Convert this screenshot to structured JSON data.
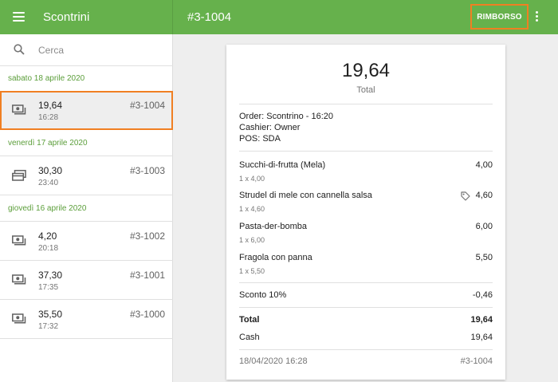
{
  "topbar": {
    "title": "Scontrini",
    "receipt_number": "#3-1004",
    "refund_label": "RIMBORSO"
  },
  "search": {
    "placeholder": "Cerca"
  },
  "groups": [
    {
      "date": "sabato 18 aprile 2020",
      "receipts": [
        {
          "amount": "19,64",
          "time": "16:28",
          "number": "#3-1004",
          "icon": "cash-icon",
          "selected": true
        }
      ]
    },
    {
      "date": "venerdì 17 aprile 2020",
      "receipts": [
        {
          "amount": "30,30",
          "time": "23:40",
          "number": "#3-1003",
          "icon": "card-icon"
        }
      ]
    },
    {
      "date": "giovedì 16 aprile 2020",
      "receipts": [
        {
          "amount": "4,20",
          "time": "20:18",
          "number": "#3-1002",
          "icon": "cash-icon"
        },
        {
          "amount": "37,30",
          "time": "17:35",
          "number": "#3-1001",
          "icon": "cash-icon"
        },
        {
          "amount": "35,50",
          "time": "17:32",
          "number": "#3-1000",
          "icon": "cash-icon"
        }
      ]
    }
  ],
  "receipt": {
    "total": "19,64",
    "total_label": "Total",
    "order": "Order: Scontrino - 16:20",
    "cashier": "Cashier: Owner",
    "pos": "POS: SDA",
    "items": [
      {
        "name": "Succhi-di-frutta (Mela)",
        "qty": "1 x 4,00",
        "price": "4,00"
      },
      {
        "name": "Strudel di mele con cannella salsa",
        "qty": "1 x 4,60",
        "price": "4,60",
        "tag_icon": "tag-icon"
      },
      {
        "name": "Pasta-der-bomba",
        "qty": "1 x 6,00",
        "price": "6,00"
      },
      {
        "name": "Fragola con panna",
        "qty": "1 x 5,50",
        "price": "5,50"
      }
    ],
    "discount_label": "Sconto 10%",
    "discount_value": "-0,46",
    "total_row_label": "Total",
    "total_row_value": "19,64",
    "payment_label": "Cash",
    "payment_value": "19,64",
    "footer_date": "18/04/2020 16:28",
    "footer_number": "#3-1004"
  },
  "colors": {
    "topbar": "#66b14c",
    "accent_green": "#5b9e3a",
    "highlight": "#f07f22"
  }
}
